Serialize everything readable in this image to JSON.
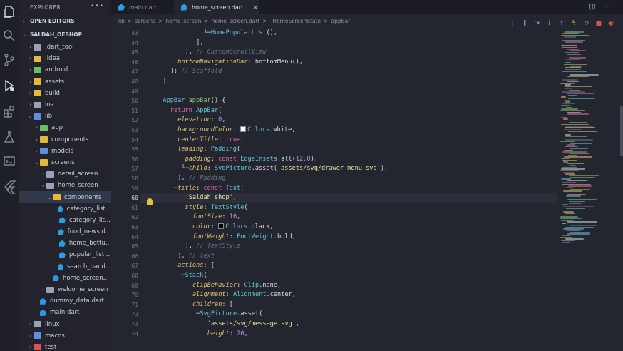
{
  "explorer": {
    "title": "EXPLORER",
    "more_icon": "ellipsis-icon",
    "open_editors_label": "OPEN EDITORS",
    "project_label": "SALDAH_OESHOP",
    "tree": [
      {
        "label": ".dart_tool",
        "depth": 0,
        "chev": "›",
        "icon": "folder-gray"
      },
      {
        "label": ".idea",
        "depth": 0,
        "chev": "›",
        "icon": "folder"
      },
      {
        "label": "android",
        "depth": 0,
        "chev": "›",
        "icon": "folder-green"
      },
      {
        "label": "assets",
        "depth": 0,
        "chev": "›",
        "icon": "folder"
      },
      {
        "label": "build",
        "depth": 0,
        "chev": "›",
        "icon": "folder"
      },
      {
        "label": "ios",
        "depth": 0,
        "chev": "›",
        "icon": "folder-gray"
      },
      {
        "label": "lib",
        "depth": 0,
        "chev": "⌄",
        "icon": "folder-blue"
      },
      {
        "label": "app",
        "depth": 1,
        "chev": "›",
        "icon": "folder-green"
      },
      {
        "label": "components",
        "depth": 1,
        "chev": "›",
        "icon": "folder"
      },
      {
        "label": "models",
        "depth": 1,
        "chev": "›",
        "icon": "folder-blue"
      },
      {
        "label": "screens",
        "depth": 1,
        "chev": "⌄",
        "icon": "folder"
      },
      {
        "label": "detail_screen",
        "depth": 2,
        "chev": "›",
        "icon": "folder-gray"
      },
      {
        "label": "home_screen",
        "depth": 2,
        "chev": "⌄",
        "icon": "folder-gray"
      },
      {
        "label": "components",
        "depth": 3,
        "chev": "⌄",
        "icon": "folder",
        "active": true
      },
      {
        "label": "category_list...",
        "depth": 4,
        "chev": "",
        "icon": "dart"
      },
      {
        "label": "category_lit...",
        "depth": 4,
        "chev": "",
        "icon": "dart"
      },
      {
        "label": "food_news.d...",
        "depth": 4,
        "chev": "",
        "icon": "dart"
      },
      {
        "label": "home_bottu...",
        "depth": 4,
        "chev": "",
        "icon": "dart"
      },
      {
        "label": "popular_list...",
        "depth": 4,
        "chev": "",
        "icon": "dart"
      },
      {
        "label": "search_band...",
        "depth": 4,
        "chev": "",
        "icon": "dart"
      },
      {
        "label": "home_screen...",
        "depth": 3,
        "chev": "",
        "icon": "dart"
      },
      {
        "label": "welcome_screen",
        "depth": 2,
        "chev": "›",
        "icon": "folder-gray"
      },
      {
        "label": "dummy_data.dart",
        "depth": 1,
        "chev": "",
        "icon": "dart"
      },
      {
        "label": "main.dart",
        "depth": 1,
        "chev": "",
        "icon": "dart"
      },
      {
        "label": "linux",
        "depth": 0,
        "chev": "›",
        "icon": "folder-gray"
      },
      {
        "label": "macos",
        "depth": 0,
        "chev": "›",
        "icon": "folder-blue"
      },
      {
        "label": "test",
        "depth": 0,
        "chev": "›",
        "icon": "folder-red"
      }
    ]
  },
  "tabs": [
    {
      "label": "main.dart",
      "active": false
    },
    {
      "label": "home_screen.dart",
      "active": true,
      "close": "×"
    }
  ],
  "breadcrumb": [
    "lib",
    ">",
    "screens",
    ">",
    "home_screen",
    ">",
    "home_screen.dart",
    ">",
    "_HomeScreenState",
    ">",
    "appBar"
  ],
  "colors": {
    "accent": "#e8c34a",
    "stop": "#e05050",
    "restart": "#6cbf62"
  },
  "code": {
    "current_line": 60,
    "lines": [
      {
        "n": 43,
        "t": [
          [
            "pl",
            "  └─"
          ],
          [
            "ty",
            "HomePopularList"
          ],
          [
            "pl",
            "(),"
          ]
        ],
        "indent": 11
      },
      {
        "n": 44,
        "t": [
          [
            "pl",
            "  ],"
          ]
        ],
        "indent": 9
      },
      {
        "n": 45,
        "t": [
          [
            "pl",
            "), "
          ],
          [
            "cm",
            "// CustomScrollView"
          ]
        ],
        "indent": 8
      },
      {
        "n": 46,
        "t": [
          [
            "pr",
            "bottomNavigationBar"
          ],
          [
            "pl",
            ": bottomMenu(),"
          ]
        ],
        "indent": 6
      },
      {
        "n": 47,
        "t": [
          [
            "pl",
            "); "
          ],
          [
            "cm",
            "// Scaffold"
          ]
        ],
        "indent": 4
      },
      {
        "n": 48,
        "t": [
          [
            "br",
            "}"
          ]
        ],
        "indent": 2
      },
      {
        "n": 49,
        "t": [],
        "indent": 0
      },
      {
        "n": 50,
        "t": [
          [
            "ty",
            "AppBar"
          ],
          [
            "pl",
            " "
          ],
          [
            "fn",
            "appBar"
          ],
          [
            "pl",
            "() {"
          ]
        ],
        "indent": 2
      },
      {
        "n": 51,
        "t": [
          [
            "kw",
            "return"
          ],
          [
            "pl",
            " "
          ],
          [
            "ty",
            "AppBar"
          ],
          [
            "pl",
            "("
          ]
        ],
        "indent": 4
      },
      {
        "n": 52,
        "t": [
          [
            "pr",
            "elevation"
          ],
          [
            "pl",
            ": "
          ],
          [
            "nu",
            "0"
          ],
          [
            "pl",
            ","
          ]
        ],
        "indent": 6
      },
      {
        "n": 53,
        "t": [
          [
            "pr",
            "backgroundColor"
          ],
          [
            "pl",
            ": "
          ],
          [
            "sw",
            "w"
          ],
          [
            "ty",
            "Colors"
          ],
          [
            "pl",
            ".white,"
          ]
        ],
        "indent": 6
      },
      {
        "n": 54,
        "t": [
          [
            "pr",
            "centerTitle"
          ],
          [
            "pl",
            ": "
          ],
          [
            "kw",
            "true"
          ],
          [
            "pl",
            ","
          ]
        ],
        "indent": 6
      },
      {
        "n": 55,
        "t": [
          [
            "pr",
            "leading"
          ],
          [
            "pl",
            ": "
          ],
          [
            "ty",
            "Padding"
          ],
          [
            "pl",
            "("
          ]
        ],
        "indent": 6
      },
      {
        "n": 56,
        "t": [
          [
            "pr",
            "padding"
          ],
          [
            "pl",
            ": "
          ],
          [
            "kw",
            "const"
          ],
          [
            "pl",
            " "
          ],
          [
            "ty",
            "EdgeInsets"
          ],
          [
            "pl",
            ".all("
          ],
          [
            "nu",
            "12.0"
          ],
          [
            "pl",
            "),"
          ]
        ],
        "indent": 8
      },
      {
        "n": 57,
        "t": [
          [
            "pl",
            "└─"
          ],
          [
            "pr",
            "child"
          ],
          [
            "pl",
            ": "
          ],
          [
            "ty",
            "SvgPicture"
          ],
          [
            "pl",
            ".asset("
          ],
          [
            "st",
            "'assets/svg/drawer_menu.svg'"
          ],
          [
            "pl",
            "),"
          ]
        ],
        "indent": 7
      },
      {
        "n": 58,
        "t": [
          [
            "pl",
            "), "
          ],
          [
            "cm",
            "// Padding"
          ]
        ],
        "indent": 6
      },
      {
        "n": 59,
        "t": [
          [
            "pl",
            "─"
          ],
          [
            "pr",
            "title"
          ],
          [
            "pl",
            ": "
          ],
          [
            "kw",
            "const"
          ],
          [
            "pl",
            " "
          ],
          [
            "ty",
            "Text"
          ],
          [
            "br",
            "("
          ]
        ],
        "indent": 5
      },
      {
        "n": 60,
        "t": [
          [
            "st",
            "'Saldah shop'"
          ],
          [
            "pl",
            ","
          ]
        ],
        "indent": 8
      },
      {
        "n": 61,
        "t": [
          [
            "pr",
            "style"
          ],
          [
            "pl",
            ": "
          ],
          [
            "ty",
            "TextStyle"
          ],
          [
            "pl",
            "("
          ]
        ],
        "indent": 8
      },
      {
        "n": 62,
        "t": [
          [
            "pr",
            "fontSize"
          ],
          [
            "pl",
            ": "
          ],
          [
            "nu",
            "16"
          ],
          [
            "pl",
            ","
          ]
        ],
        "indent": 10
      },
      {
        "n": 63,
        "t": [
          [
            "pr",
            "color"
          ],
          [
            "pl",
            ": "
          ],
          [
            "sw",
            "b"
          ],
          [
            "ty",
            "Colors"
          ],
          [
            "pl",
            ".black,"
          ]
        ],
        "indent": 10
      },
      {
        "n": 64,
        "t": [
          [
            "pr",
            "fontWeight"
          ],
          [
            "pl",
            ": "
          ],
          [
            "ty",
            "FontWeight"
          ],
          [
            "pl",
            ".bold,"
          ]
        ],
        "indent": 10
      },
      {
        "n": 65,
        "t": [
          [
            "pl",
            "), "
          ],
          [
            "cm",
            "// TextStyle"
          ]
        ],
        "indent": 8
      },
      {
        "n": 66,
        "t": [
          [
            "br",
            ")"
          ],
          [
            "pl",
            ", "
          ],
          [
            "cm",
            "// Text"
          ]
        ],
        "indent": 6
      },
      {
        "n": 67,
        "t": [
          [
            "pr",
            "actions"
          ],
          [
            "pl",
            ": ["
          ]
        ],
        "indent": 6
      },
      {
        "n": 68,
        "t": [
          [
            "pl",
            "─"
          ],
          [
            "ty",
            "Stack"
          ],
          [
            "pl",
            "("
          ]
        ],
        "indent": 7
      },
      {
        "n": 69,
        "t": [
          [
            "pr",
            "clipBehavior"
          ],
          [
            "pl",
            ": "
          ],
          [
            "ty",
            "Clip"
          ],
          [
            "pl",
            ".none,"
          ]
        ],
        "indent": 10
      },
      {
        "n": 70,
        "t": [
          [
            "pr",
            "alignment"
          ],
          [
            "pl",
            ": "
          ],
          [
            "ty",
            "Alignment"
          ],
          [
            "pl",
            ".center,"
          ]
        ],
        "indent": 10
      },
      {
        "n": 71,
        "t": [
          [
            "pr",
            "children"
          ],
          [
            "pl",
            ": ["
          ]
        ],
        "indent": 10
      },
      {
        "n": 72,
        "t": [
          [
            "pl",
            "─"
          ],
          [
            "ty",
            "SvgPicture"
          ],
          [
            "pl",
            ".asset("
          ]
        ],
        "indent": 11
      },
      {
        "n": 73,
        "t": [
          [
            "st",
            "'assets/svg/message.svg'"
          ],
          [
            "pl",
            ","
          ]
        ],
        "indent": 14
      },
      {
        "n": 74,
        "t": [
          [
            "pr",
            "height"
          ],
          [
            "pl",
            ": "
          ],
          [
            "nu",
            "20"
          ],
          [
            "pl",
            ","
          ]
        ],
        "indent": 14
      }
    ]
  }
}
